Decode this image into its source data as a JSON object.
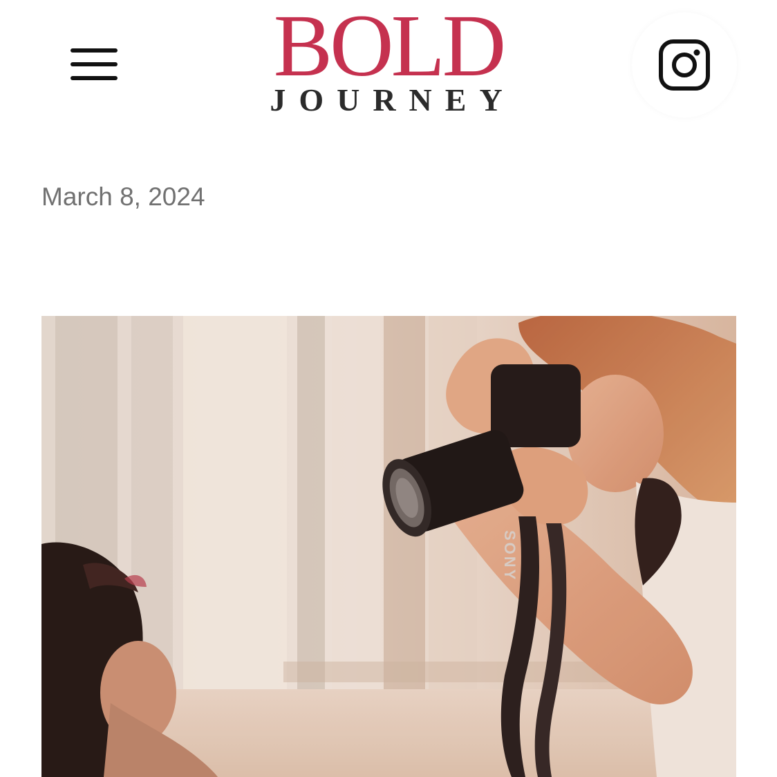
{
  "header": {
    "menu_icon": "hamburger-menu-icon",
    "logo": {
      "line1": "BOLD",
      "line2": "JOURNEY"
    },
    "social_icon": "instagram-icon"
  },
  "post": {
    "date": "March 8, 2024",
    "featured_image": {
      "camera_brand_text": "SONY"
    }
  },
  "colors": {
    "accent": "#c5314f",
    "logo_dark": "#2b2b2b",
    "date_text": "#717171",
    "icon": "#111111"
  }
}
